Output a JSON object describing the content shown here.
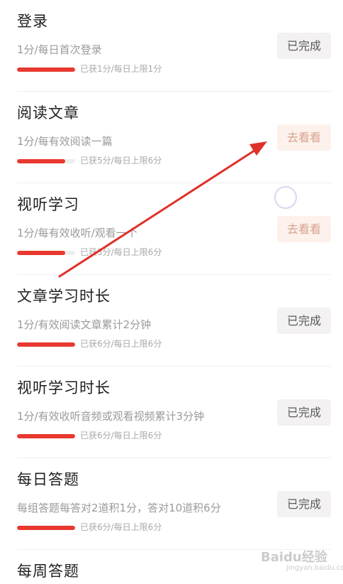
{
  "tasks": [
    {
      "title": "登录",
      "desc": "1分/每日首次登录",
      "progress": "已获1分/每日上限1分",
      "progress_fraction": 1.0,
      "button": "已完成",
      "button_state": "done"
    },
    {
      "title": "阅读文章",
      "desc": "1分/每有效阅读一篇",
      "progress": "已获5分/每日上限6分",
      "progress_fraction": 0.83,
      "button": "去看看",
      "button_state": "go"
    },
    {
      "title": "视听学习",
      "desc": "1分/每有效收听/观看一个",
      "progress": "已获5分/每日上限6分",
      "progress_fraction": 0.83,
      "button": "去看看",
      "button_state": "go"
    },
    {
      "title": "文章学习时长",
      "desc": "1分/有效阅读文章累计2分钟",
      "progress": "已获6分/每日上限6分",
      "progress_fraction": 1.0,
      "button": "已完成",
      "button_state": "done"
    },
    {
      "title": "视听学习时长",
      "desc": "1分/有效收听音频或观看视频累计3分钟",
      "progress": "已获6分/每日上限6分",
      "progress_fraction": 1.0,
      "button": "已完成",
      "button_state": "done"
    },
    {
      "title": "每日答题",
      "desc": "每组答题每答对2道积1分，答对10道积6分",
      "progress": "已获6分/每日上限6分",
      "progress_fraction": 1.0,
      "button": "已完成",
      "button_state": "done"
    },
    {
      "title": "每周答题",
      "desc": "",
      "progress": "",
      "button": "",
      "button_state": "none"
    }
  ],
  "colors": {
    "accent": "#e8392f",
    "done_button_bg": "#f3f1f1",
    "go_button_bg": "#fdf1ec",
    "annotation_arrow": "#e0302a"
  },
  "icons": {
    "loading": "loading-spinner-icon",
    "annotation": "red-arrow-annotation"
  },
  "watermark": {
    "text": "Baidu经验",
    "sub": "jingyan.baidu.com"
  }
}
